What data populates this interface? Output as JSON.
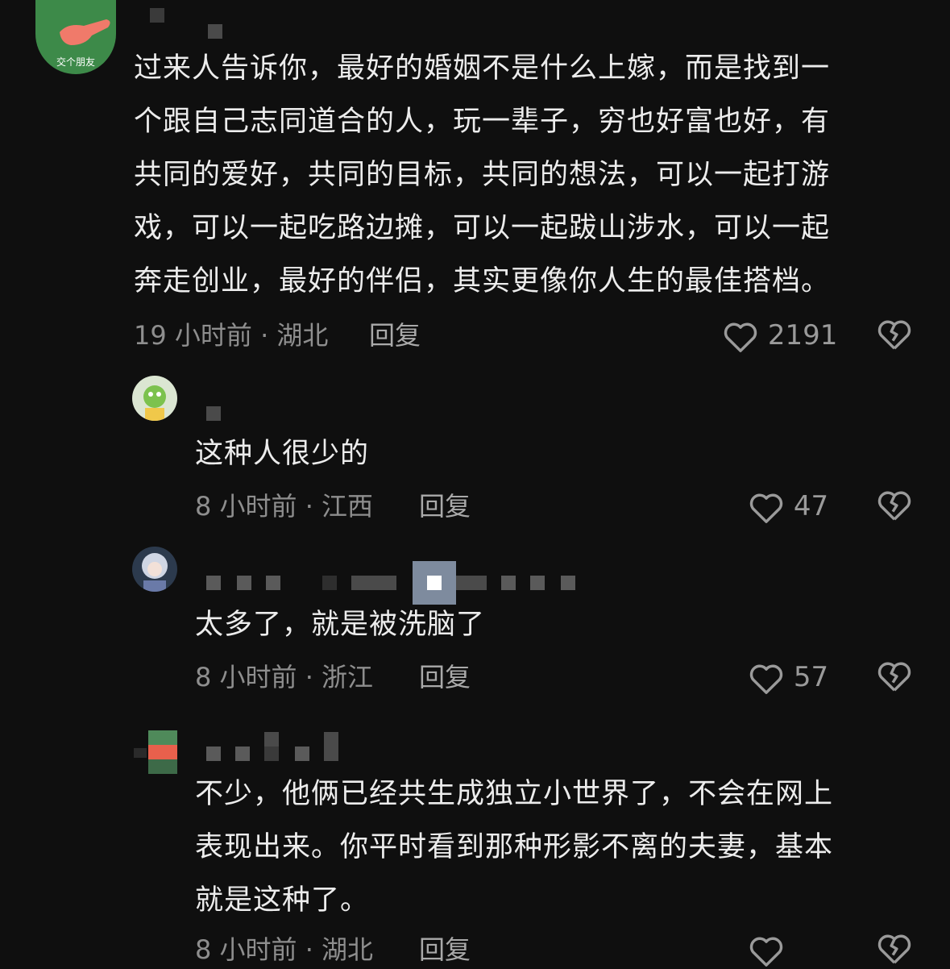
{
  "comments": [
    {
      "avatar_label": "交个朋友",
      "text": "过来人告诉你，最好的婚姻不是什么上嫁，而是找到一\n个跟自己志同道合的人，玩一辈子，穷也好富也好，有\n共同的爱好，共同的目标，共同的想法，可以一起打游\n戏，可以一起吃路边摊，可以一起跋山涉水，可以一起\n奔走创业，最好的伴侣，其实更像你人生的最佳搭档。",
      "time": "19 小时前 · 湖北",
      "reply_label": "回复",
      "likes": "2191"
    },
    {
      "text": "这种人很少的",
      "time": "8 小时前 · 江西",
      "reply_label": "回复",
      "likes": "47"
    },
    {
      "text": "太多了，就是被洗脑了",
      "time": "8 小时前 · 浙江",
      "reply_label": "回复",
      "likes": "57"
    },
    {
      "text": "不少，他俩已经共生成独立小世界了，不会在网上\n表现出来。你平时看到那种形影不离的夫妻，基本\n就是这种了。",
      "time": "8 小时前 · 湖北",
      "reply_label": "回复",
      "likes": ""
    }
  ],
  "icons": {
    "like": "heart-outline-icon",
    "dislike": "broken-heart-icon"
  },
  "colors": {
    "background": "#0f0f0f",
    "text": "#ececec",
    "meta": "#8e8e8e",
    "avatar1_bg": "#3f8a4a",
    "avatar1_hand": "#f07a6a"
  }
}
